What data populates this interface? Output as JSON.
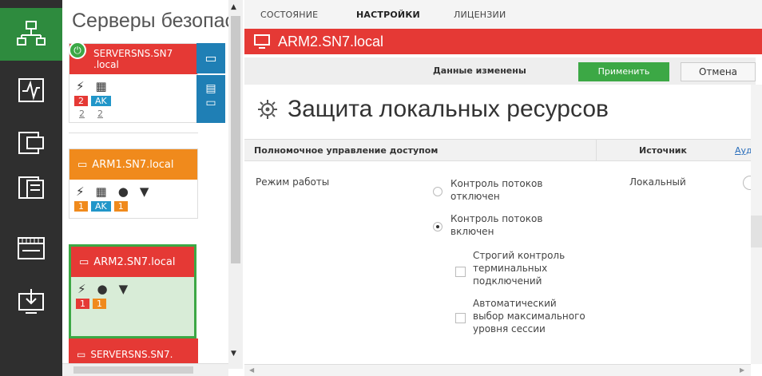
{
  "rail": {
    "items": [
      {
        "icon": "network-icon",
        "active": true
      },
      {
        "icon": "activity-icon",
        "active": false
      },
      {
        "icon": "monitor-list-icon",
        "active": false
      },
      {
        "icon": "server-list-icon",
        "active": false
      },
      {
        "icon": "switch-icon",
        "active": false
      },
      {
        "icon": "download-icon",
        "active": false
      }
    ]
  },
  "servers": {
    "title": "Серверы безопасн",
    "cards": [
      {
        "name": "SERVERSNS.SN7",
        "name2": ".local",
        "color": "#e53935",
        "badges": [
          "2",
          "AK"
        ],
        "badges2": [
          "2",
          "2"
        ]
      },
      {
        "name": "ARM1.SN7.local",
        "color": "#f08a1c",
        "badges": [
          "1",
          "AK",
          "1"
        ]
      },
      {
        "name": "ARM2.SN7.local",
        "color": "#e53935",
        "badges": [
          "1",
          "1"
        ]
      },
      {
        "name": "SERVERSNS.SN7.",
        "color": "#e53935"
      }
    ]
  },
  "tabs": [
    "СОСТОЯНИЕ",
    "НАСТРОЙКИ",
    "ЛИЦЕНЗИИ"
  ],
  "active_tab": "НАСТРОЙКИ",
  "host_title": "ARM2.SN7.local",
  "status": {
    "text": "Данные изменены",
    "apply": "Применить",
    "cancel": "Отмена"
  },
  "page_title": "Защита локальных ресурсов",
  "table": {
    "col1": "Полномочное управление доступом",
    "col2": "Источник",
    "col3": "Ауд"
  },
  "settings": {
    "mode_label": "Режим работы",
    "source_value": "Локальный",
    "options": [
      {
        "line1": "Контроль потоков",
        "line2": "отключен",
        "selected": false
      },
      {
        "line1": "Контроль потоков",
        "line2": "включен",
        "selected": true
      }
    ],
    "checkboxes": [
      {
        "line1": "Строгий контроль",
        "line2": "терминальных",
        "line3": "подключений",
        "checked": false
      },
      {
        "line1": "Автоматический",
        "line2": "выбор максимального",
        "line3": "уровня сессии",
        "checked": false
      }
    ]
  },
  "colors": {
    "accent_green": "#2e8b3e",
    "red": "#e53935",
    "orange": "#f08a1c",
    "apply_green": "#3ca845"
  }
}
